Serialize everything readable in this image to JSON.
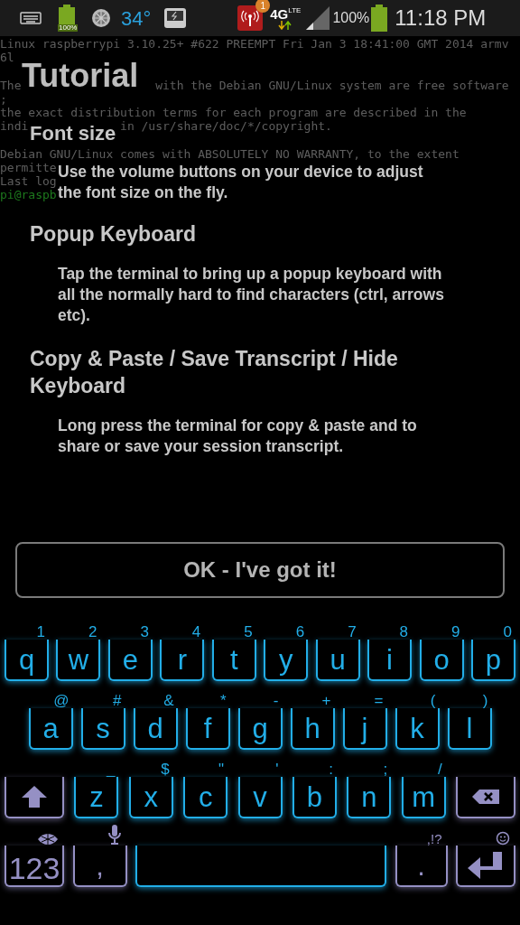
{
  "status_bar": {
    "small_battery": "100%",
    "temperature": "34°",
    "notification_count": "1",
    "network": "4G",
    "network_sub": "LTE",
    "battery": "100%",
    "time": "11:18 PM"
  },
  "terminal": {
    "lines": [
      {
        "text": "Linux raspberrypi 3.10.25+ #622 PREEMPT Fri Jan 3 18:41:00 GMT 2014 armv",
        "kind": "output"
      },
      {
        "text": "6l",
        "kind": "output"
      },
      {
        "kind": "blank"
      },
      {
        "text": "The                   with the Debian GNU/Linux system are free software",
        "kind": "output"
      },
      {
        "text": ";",
        "kind": "output"
      },
      {
        "text": "the exact distribution terms for each program are described in the",
        "kind": "output"
      },
      {
        "text": "indi             in /usr/share/doc/*/copyright.",
        "kind": "output"
      },
      {
        "kind": "blank"
      },
      {
        "text": "Debian GNU/Linux comes with ABSOLUTELY NO WARRANTY, to the extent",
        "kind": "output"
      },
      {
        "text": "permitte",
        "kind": "output"
      },
      {
        "text": "Last log",
        "kind": "output"
      },
      {
        "text": "pi@raspb",
        "kind": "prompt"
      }
    ]
  },
  "tutorial": {
    "title": "Tutorial",
    "sections": [
      {
        "heading": "Font size",
        "body": "Use the volume buttons on your device to adjust the font size on the fly."
      },
      {
        "heading": "Popup Keyboard",
        "body": "Tap the terminal to bring up a popup keyboard with all the normally hard to find characters (ctrl, arrows etc)."
      },
      {
        "heading": "Copy & Paste / Save Transcript / Hide Keyboard",
        "body": "Long press the terminal for copy & paste and to share or save your session transcript."
      }
    ],
    "button": "OK - I've got it!"
  },
  "keyboard": {
    "rows": [
      {
        "keys": [
          {
            "kind": "letter",
            "label": "q",
            "hint": "1"
          },
          {
            "kind": "letter",
            "label": "w",
            "hint": "2"
          },
          {
            "kind": "letter",
            "label": "e",
            "hint": "3"
          },
          {
            "kind": "letter",
            "label": "r",
            "hint": "4"
          },
          {
            "kind": "letter",
            "label": "t",
            "hint": "5"
          },
          {
            "kind": "letter",
            "label": "y",
            "hint": "6"
          },
          {
            "kind": "letter",
            "label": "u",
            "hint": "7"
          },
          {
            "kind": "letter",
            "label": "i",
            "hint": "8"
          },
          {
            "kind": "letter",
            "label": "o",
            "hint": "9"
          },
          {
            "kind": "letter",
            "label": "p",
            "hint": "0"
          }
        ]
      },
      {
        "keys": [
          {
            "kind": "letter",
            "label": "a",
            "hint": "@"
          },
          {
            "kind": "letter",
            "label": "s",
            "hint": "#"
          },
          {
            "kind": "letter",
            "label": "d",
            "hint": "&"
          },
          {
            "kind": "letter",
            "label": "f",
            "hint": "*"
          },
          {
            "kind": "letter",
            "label": "g",
            "hint": "-"
          },
          {
            "kind": "letter",
            "label": "h",
            "hint": "+"
          },
          {
            "kind": "letter",
            "label": "j",
            "hint": "="
          },
          {
            "kind": "letter",
            "label": "k",
            "hint": "("
          },
          {
            "kind": "letter",
            "label": "l",
            "hint": ")"
          }
        ]
      },
      {
        "keys": [
          {
            "kind": "shift"
          },
          {
            "kind": "letter",
            "label": "z",
            "hint": "_"
          },
          {
            "kind": "letter",
            "label": "x",
            "hint": "$"
          },
          {
            "kind": "letter",
            "label": "c",
            "hint": "\""
          },
          {
            "kind": "letter",
            "label": "v",
            "hint": "'"
          },
          {
            "kind": "letter",
            "label": "b",
            "hint": ":"
          },
          {
            "kind": "letter",
            "label": "n",
            "hint": ";"
          },
          {
            "kind": "letter",
            "label": "m",
            "hint": "/"
          },
          {
            "kind": "backspace"
          }
        ]
      },
      {
        "keys": [
          {
            "kind": "mode",
            "label": "123"
          },
          {
            "kind": "comma",
            "label": ","
          },
          {
            "kind": "space"
          },
          {
            "kind": "period",
            "label": ".",
            "hint": ",!?"
          },
          {
            "kind": "enter"
          }
        ]
      }
    ]
  }
}
